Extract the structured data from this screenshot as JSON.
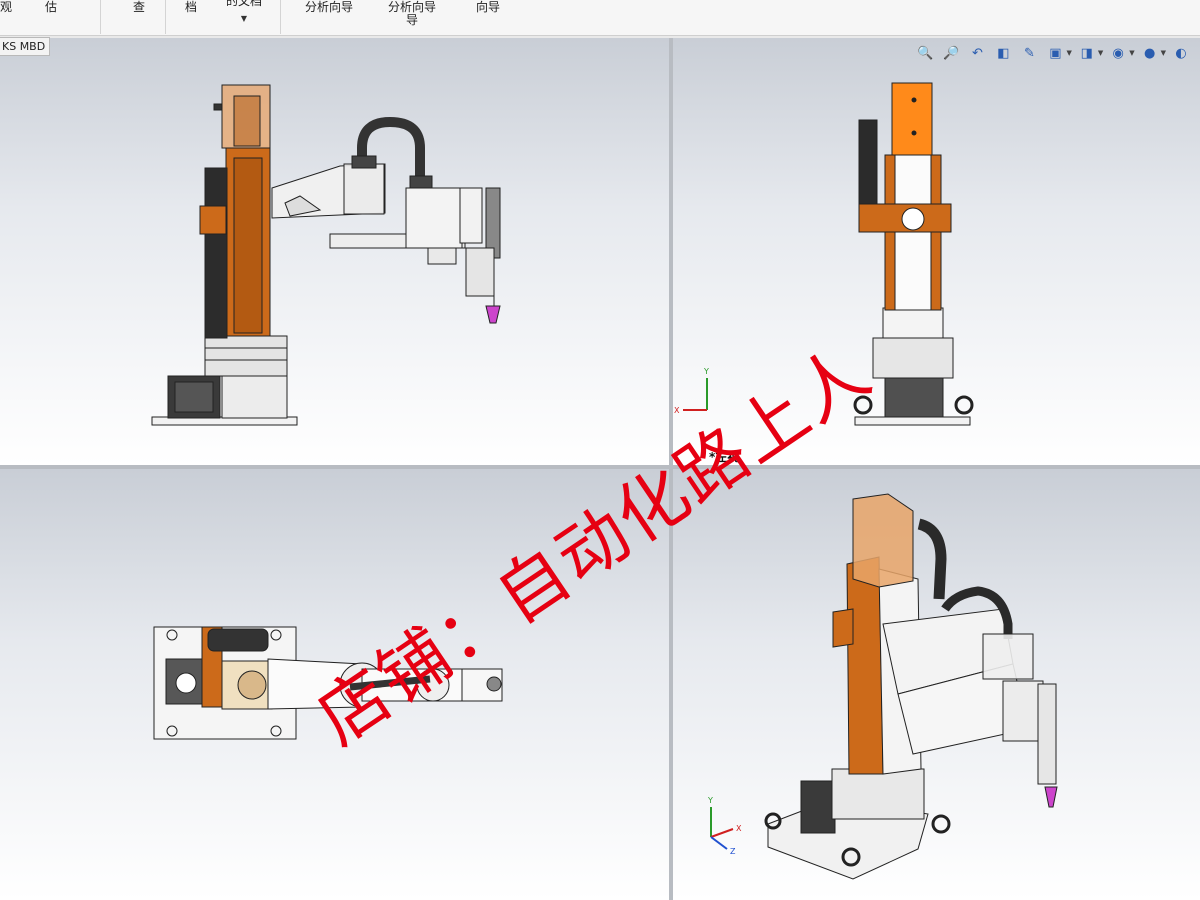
{
  "ribbon": {
    "items": [
      {
        "label": "观"
      },
      {
        "label": "估"
      },
      {
        "label": "查"
      },
      {
        "label": "档"
      },
      {
        "label": "的文档"
      },
      {
        "label": "分析向导"
      },
      {
        "label": "分析向导",
        "label2": "导"
      },
      {
        "label": "向导"
      }
    ]
  },
  "tabs": {
    "mbd": "KS MBD"
  },
  "views": {
    "trimetric_label": "*左视",
    "triad": {
      "x": "X",
      "y": "Y",
      "z": "Z"
    }
  },
  "hud_icons": [
    "zoom-to-fit-icon",
    "zoom-area-icon",
    "previous-view-icon",
    "section-view-icon",
    "dynamic-annotation-icon",
    "view-orientation-icon",
    "display-style-icon",
    "hide-show-icon",
    "edit-appearance-icon",
    "apply-scene-icon"
  ],
  "watermark": "店铺：自动化路上人",
  "colors": {
    "accent_orange": "#cc6a1a",
    "watermark_red": "#e60012"
  }
}
